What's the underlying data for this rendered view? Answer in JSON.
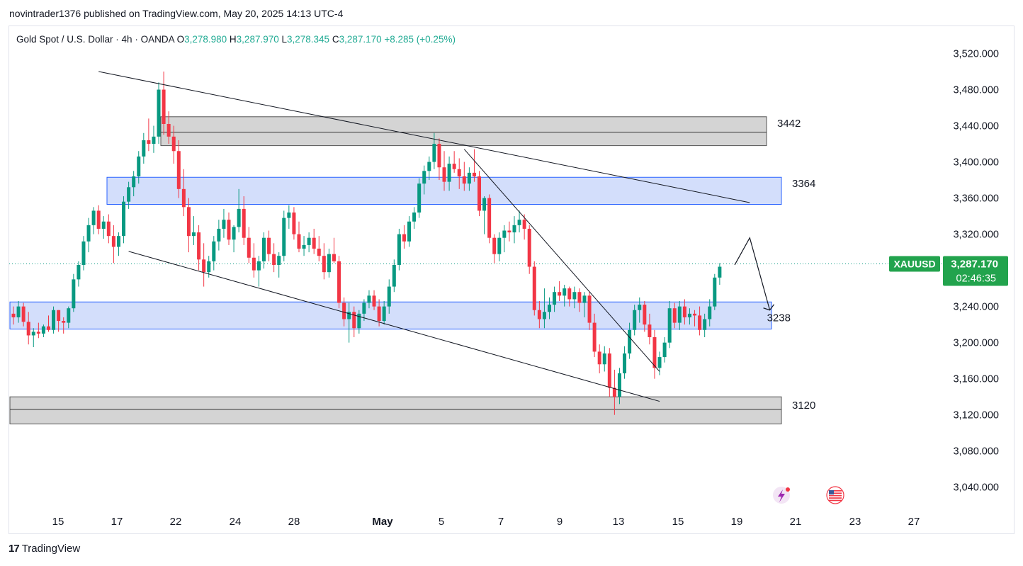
{
  "header": {
    "publish_line": "novintrader1376 published on TradingView.com, May 20, 2025 14:13 UTC-4"
  },
  "legend": {
    "symbol": "Gold Spot / U.S. Dollar · 4h · OANDA",
    "open_label": "O",
    "open": "3,278.980",
    "high_label": "H",
    "high": "3,287.970",
    "low_label": "L",
    "low": "3,278.345",
    "close_label": "C",
    "close": "3,287.170",
    "change": "+8.285 (+0.25%)"
  },
  "price_tag": {
    "symbol": "XAUUSD",
    "price": "3,287.170",
    "countdown": "02:46:35"
  },
  "footer": {
    "brand": "TradingView",
    "logo_text": "17"
  },
  "colors": {
    "up": "#089981",
    "down": "#f23645",
    "zone_blue": "#d1dcfb",
    "zone_blue_border": "#2962ff",
    "zone_gray": "#d4d4d4",
    "zone_gray_border": "#555555",
    "tag_green": "#22a34d",
    "legend_green": "#22ab94"
  },
  "icons": [
    "lightning-event-icon",
    "us-flag-icon"
  ],
  "chart_data": {
    "type": "candlestick",
    "timeframe": "4h",
    "ylim": [
      3010,
      3540
    ],
    "y_ticks": [
      "3,520.000",
      "3,480.000",
      "3,440.000",
      "3,400.000",
      "3,360.000",
      "3,320.000",
      "3,240.000",
      "3,200.000",
      "3,160.000",
      "3,120.000",
      "3,080.000",
      "3,040.000"
    ],
    "y_tick_values": [
      3520,
      3480,
      3440,
      3400,
      3360,
      3320,
      3240,
      3200,
      3160,
      3120,
      3080,
      3040
    ],
    "x_ticks": [
      "15",
      "17",
      "22",
      "24",
      "28",
      "May",
      "5",
      "7",
      "9",
      "13",
      "15",
      "19",
      "21",
      "23",
      "27"
    ],
    "current_price": 3287.17,
    "zones": [
      {
        "label": "3442",
        "top": 3450,
        "bottom": 3418,
        "mid": 3433,
        "style": "gray"
      },
      {
        "label": "3364",
        "top": 3383,
        "bottom": 3353,
        "style": "blue"
      },
      {
        "label": "",
        "top": 3245,
        "bottom": 3215,
        "style": "blue"
      },
      {
        "label": "3120",
        "top": 3140,
        "bottom": 3110,
        "mid": 3126,
        "style": "gray"
      }
    ],
    "projection_label": "3238",
    "candles": [
      [
        3232,
        3240,
        3220,
        3228
      ],
      [
        3228,
        3246,
        3222,
        3240
      ],
      [
        3240,
        3244,
        3218,
        3223
      ],
      [
        3223,
        3234,
        3198,
        3208
      ],
      [
        3208,
        3216,
        3195,
        3212
      ],
      [
        3212,
        3222,
        3205,
        3210
      ],
      [
        3210,
        3220,
        3206,
        3218
      ],
      [
        3218,
        3230,
        3212,
        3214
      ],
      [
        3214,
        3240,
        3210,
        3236
      ],
      [
        3236,
        3236,
        3212,
        3224
      ],
      [
        3224,
        3228,
        3210,
        3222
      ],
      [
        3222,
        3240,
        3216,
        3238
      ],
      [
        3238,
        3276,
        3234,
        3270
      ],
      [
        3270,
        3290,
        3262,
        3286
      ],
      [
        3286,
        3318,
        3280,
        3312
      ],
      [
        3312,
        3338,
        3300,
        3330
      ],
      [
        3330,
        3350,
        3320,
        3346
      ],
      [
        3346,
        3352,
        3320,
        3326
      ],
      [
        3326,
        3340,
        3315,
        3334
      ],
      [
        3334,
        3342,
        3310,
        3318
      ],
      [
        3318,
        3330,
        3288,
        3306
      ],
      [
        3306,
        3322,
        3296,
        3318
      ],
      [
        3318,
        3362,
        3310,
        3356
      ],
      [
        3356,
        3378,
        3348,
        3372
      ],
      [
        3372,
        3390,
        3362,
        3384
      ],
      [
        3384,
        3412,
        3376,
        3406
      ],
      [
        3406,
        3432,
        3398,
        3424
      ],
      [
        3424,
        3448,
        3412,
        3420
      ],
      [
        3420,
        3440,
        3410,
        3428
      ],
      [
        3428,
        3488,
        3420,
        3480
      ],
      [
        3480,
        3500,
        3430,
        3442
      ],
      [
        3442,
        3456,
        3420,
        3428
      ],
      [
        3428,
        3440,
        3398,
        3412
      ],
      [
        3412,
        3424,
        3360,
        3370
      ],
      [
        3370,
        3392,
        3340,
        3350
      ],
      [
        3350,
        3360,
        3300,
        3318
      ],
      [
        3318,
        3340,
        3308,
        3322
      ],
      [
        3322,
        3330,
        3280,
        3292
      ],
      [
        3292,
        3310,
        3262,
        3278
      ],
      [
        3278,
        3296,
        3272,
        3290
      ],
      [
        3290,
        3318,
        3280,
        3312
      ],
      [
        3312,
        3336,
        3302,
        3326
      ],
      [
        3326,
        3348,
        3316,
        3336
      ],
      [
        3336,
        3344,
        3308,
        3314
      ],
      [
        3314,
        3330,
        3300,
        3328
      ],
      [
        3328,
        3370,
        3322,
        3348
      ],
      [
        3348,
        3362,
        3308,
        3316
      ],
      [
        3316,
        3328,
        3288,
        3294
      ],
      [
        3294,
        3310,
        3272,
        3280
      ],
      [
        3280,
        3296,
        3262,
        3290
      ],
      [
        3290,
        3322,
        3282,
        3316
      ],
      [
        3316,
        3324,
        3290,
        3298
      ],
      [
        3298,
        3310,
        3278,
        3286
      ],
      [
        3286,
        3300,
        3272,
        3296
      ],
      [
        3296,
        3346,
        3290,
        3338
      ],
      [
        3338,
        3352,
        3326,
        3344
      ],
      [
        3344,
        3350,
        3314,
        3320
      ],
      [
        3320,
        3334,
        3300,
        3304
      ],
      [
        3304,
        3318,
        3296,
        3308
      ],
      [
        3308,
        3322,
        3300,
        3316
      ],
      [
        3316,
        3326,
        3298,
        3304
      ],
      [
        3304,
        3318,
        3290,
        3296
      ],
      [
        3296,
        3310,
        3270,
        3278
      ],
      [
        3278,
        3304,
        3272,
        3298
      ],
      [
        3298,
        3316,
        3288,
        3290
      ],
      [
        3290,
        3296,
        3238,
        3244
      ],
      [
        3244,
        3250,
        3218,
        3226
      ],
      [
        3226,
        3244,
        3200,
        3234
      ],
      [
        3234,
        3240,
        3206,
        3216
      ],
      [
        3216,
        3236,
        3210,
        3232
      ],
      [
        3232,
        3248,
        3224,
        3244
      ],
      [
        3244,
        3258,
        3238,
        3252
      ],
      [
        3252,
        3258,
        3236,
        3240
      ],
      [
        3240,
        3248,
        3218,
        3224
      ],
      [
        3224,
        3246,
        3220,
        3240
      ],
      [
        3240,
        3270,
        3232,
        3262
      ],
      [
        3262,
        3292,
        3256,
        3286
      ],
      [
        3286,
        3326,
        3280,
        3320
      ],
      [
        3320,
        3330,
        3304,
        3312
      ],
      [
        3312,
        3340,
        3306,
        3334
      ],
      [
        3334,
        3350,
        3326,
        3344
      ],
      [
        3344,
        3382,
        3338,
        3376
      ],
      [
        3376,
        3396,
        3364,
        3390
      ],
      [
        3390,
        3406,
        3380,
        3400
      ],
      [
        3400,
        3432,
        3392,
        3420
      ],
      [
        3420,
        3426,
        3380,
        3394
      ],
      [
        3394,
        3412,
        3368,
        3378
      ],
      [
        3378,
        3406,
        3368,
        3398
      ],
      [
        3398,
        3412,
        3388,
        3392
      ],
      [
        3392,
        3404,
        3370,
        3384
      ],
      [
        3384,
        3400,
        3368,
        3376
      ],
      [
        3376,
        3394,
        3368,
        3388
      ],
      [
        3388,
        3414,
        3378,
        3384
      ],
      [
        3384,
        3390,
        3340,
        3346
      ],
      [
        3346,
        3362,
        3320,
        3360
      ],
      [
        3360,
        3364,
        3310,
        3316
      ],
      [
        3316,
        3320,
        3288,
        3298
      ],
      [
        3298,
        3322,
        3290,
        3316
      ],
      [
        3316,
        3330,
        3300,
        3324
      ],
      [
        3324,
        3334,
        3312,
        3322
      ],
      [
        3322,
        3340,
        3310,
        3330
      ],
      [
        3330,
        3346,
        3322,
        3336
      ],
      [
        3336,
        3342,
        3314,
        3326
      ],
      [
        3326,
        3330,
        3276,
        3284
      ],
      [
        3284,
        3290,
        3230,
        3236
      ],
      [
        3236,
        3246,
        3216,
        3226
      ],
      [
        3226,
        3260,
        3216,
        3234
      ],
      [
        3234,
        3250,
        3226,
        3242
      ],
      [
        3242,
        3262,
        3234,
        3256
      ],
      [
        3256,
        3268,
        3246,
        3252
      ],
      [
        3252,
        3264,
        3240,
        3260
      ],
      [
        3260,
        3262,
        3240,
        3248
      ],
      [
        3248,
        3262,
        3238,
        3256
      ],
      [
        3256,
        3260,
        3234,
        3244
      ],
      [
        3244,
        3256,
        3228,
        3252
      ],
      [
        3252,
        3256,
        3214,
        3222
      ],
      [
        3222,
        3232,
        3184,
        3190
      ],
      [
        3190,
        3198,
        3166,
        3176
      ],
      [
        3176,
        3196,
        3168,
        3188
      ],
      [
        3188,
        3194,
        3140,
        3150
      ],
      [
        3150,
        3170,
        3120,
        3140
      ],
      [
        3140,
        3172,
        3132,
        3166
      ],
      [
        3166,
        3196,
        3160,
        3188
      ],
      [
        3188,
        3222,
        3182,
        3214
      ],
      [
        3214,
        3242,
        3208,
        3236
      ],
      [
        3236,
        3250,
        3222,
        3242
      ],
      [
        3242,
        3246,
        3212,
        3220
      ],
      [
        3220,
        3232,
        3198,
        3206
      ],
      [
        3206,
        3214,
        3160,
        3172
      ],
      [
        3172,
        3190,
        3164,
        3184
      ],
      [
        3184,
        3206,
        3178,
        3200
      ],
      [
        3200,
        3246,
        3194,
        3238
      ],
      [
        3238,
        3244,
        3216,
        3222
      ],
      [
        3222,
        3246,
        3214,
        3240
      ],
      [
        3240,
        3248,
        3220,
        3228
      ],
      [
        3228,
        3238,
        3220,
        3232
      ],
      [
        3232,
        3236,
        3218,
        3230
      ],
      [
        3230,
        3240,
        3208,
        3214
      ],
      [
        3214,
        3232,
        3206,
        3226
      ],
      [
        3226,
        3248,
        3218,
        3240
      ],
      [
        3240,
        3276,
        3236,
        3272
      ],
      [
        3272,
        3288,
        3264,
        3284
      ]
    ],
    "annotations": {
      "trendlines": [
        {
          "from": [
            17,
            3500
          ],
          "to": [
            147,
            3355
          ]
        },
        {
          "from": [
            23,
            3301
          ],
          "to": [
            129,
            3135
          ]
        },
        {
          "from": [
            90,
            3414
          ],
          "to": [
            129,
            3168
          ]
        }
      ],
      "projection_path": [
        [
          144,
          3286
        ],
        [
          147,
          3316
        ],
        [
          151,
          3236
        ]
      ]
    }
  }
}
